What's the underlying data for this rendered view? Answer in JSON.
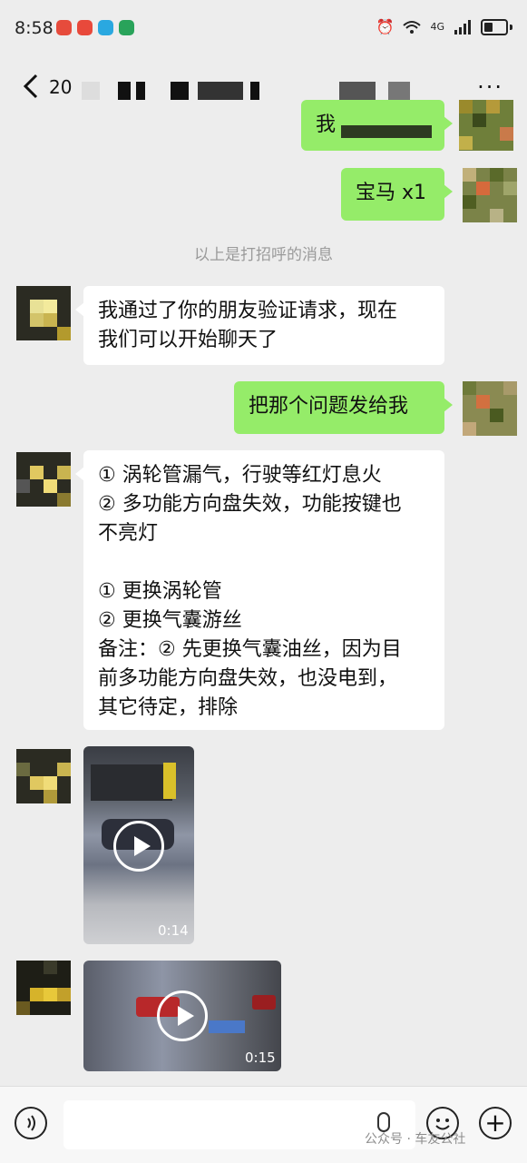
{
  "status_bar": {
    "time": "8:58",
    "network": "4G",
    "app_icon_colors": [
      "#e64b3c",
      "#e8493b",
      "#2aa8e0",
      "#29a35a"
    ]
  },
  "header": {
    "title_prefix": "20",
    "back_icon": "chevron-left-icon",
    "more_label": "···"
  },
  "messages": [
    {
      "side": "right",
      "text": "我"
    },
    {
      "side": "right",
      "text": "宝马 x1"
    },
    {
      "side": "system",
      "text": "以上是打招呼的消息"
    },
    {
      "side": "left",
      "lines": [
        "我通过了你的朋友验证请求，现在",
        "我们可以开始聊天了"
      ]
    },
    {
      "side": "right",
      "text": "把那个问题发给我"
    },
    {
      "side": "left",
      "lines": [
        "① 涡轮管漏气，行驶等红灯息火",
        "② 多功能方向盘失效，功能按键也",
        "不亮灯",
        "",
        "① 更换涡轮管",
        "② 更换气囊游丝",
        "备注：② 先更换气囊油丝，因为目",
        "前多功能方向盘失效，也没电到，",
        "其它待定，排除"
      ]
    },
    {
      "side": "left",
      "type": "video",
      "duration": "0:14"
    },
    {
      "side": "left",
      "type": "video",
      "duration": "0:15"
    }
  ],
  "input_bar": {
    "watermark": "公众号 · 车友公社"
  }
}
